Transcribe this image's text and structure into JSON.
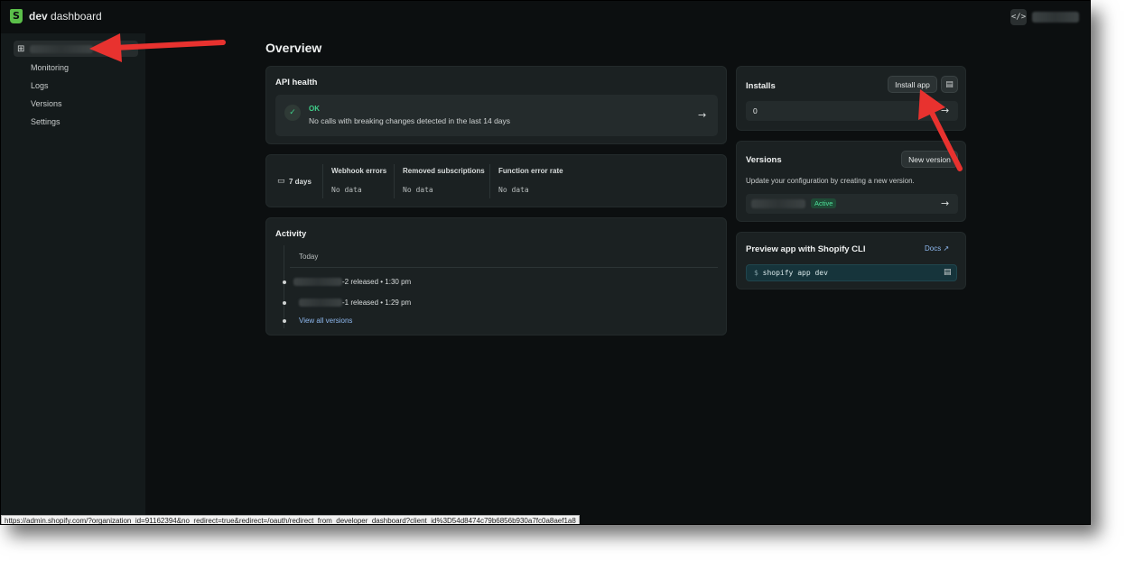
{
  "brand": {
    "bold": "dev",
    "rest": " dashboard"
  },
  "sidebar": {
    "items": [
      {
        "label": "Monitoring"
      },
      {
        "label": "Logs"
      },
      {
        "label": "Versions"
      },
      {
        "label": "Settings"
      }
    ]
  },
  "page": {
    "title": "Overview"
  },
  "api_health": {
    "title": "API health",
    "status": "OK",
    "description": "No calls with breaking changes detected in the last 14 days"
  },
  "metrics": {
    "period": "7 days",
    "columns": [
      {
        "label": "Webhook errors",
        "value": "No data"
      },
      {
        "label": "Removed subscriptions",
        "value": "No data"
      },
      {
        "label": "Function error rate",
        "value": "No data"
      }
    ]
  },
  "activity": {
    "title": "Activity",
    "group": "Today",
    "items": [
      {
        "suffix": "-2",
        "text": " released • 1:30 pm"
      },
      {
        "suffix": "-1",
        "text": " released • 1:29 pm"
      }
    ],
    "link": "View all versions"
  },
  "installs": {
    "title": "Installs",
    "button": "Install app",
    "count": "0"
  },
  "versions": {
    "title": "Versions",
    "button": "New version",
    "description": "Update your configuration by creating a new version.",
    "badge": "Active"
  },
  "preview": {
    "title": "Preview app with Shopify CLI",
    "docs": "Docs",
    "prompt": "$",
    "command": "shopify app dev"
  },
  "status_bar": {
    "url": "https://admin.shopify.com/?organization_id=91162394&no_redirect=true&redirect=/oauth/redirect_from_developer_dashboard?client_id%3D54d8474c79b6856b930a7fc0a8aef1a8"
  },
  "colors": {
    "accent_green": "#3fd08a",
    "annotation_red": "#e8322f",
    "link_blue": "#8fb9f0"
  }
}
